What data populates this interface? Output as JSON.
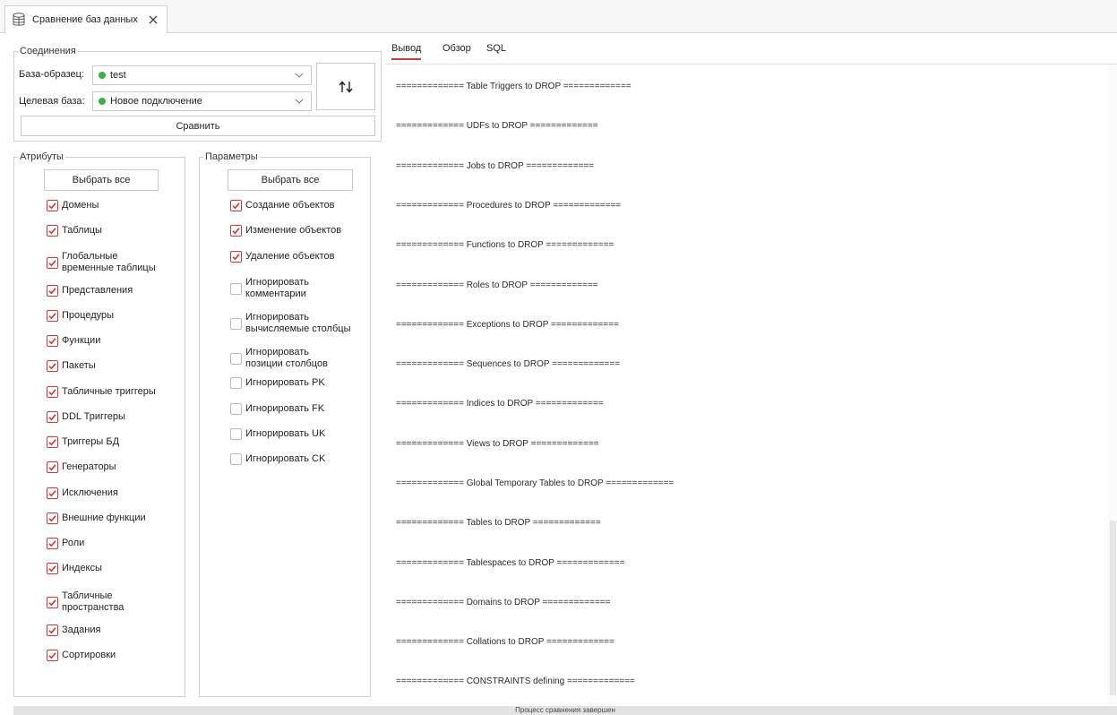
{
  "window": {
    "tab_title": "Сравнение баз данных",
    "tab_icon": "database-compare-icon",
    "close_icon": "close-icon"
  },
  "connections": {
    "title": "Соединения",
    "source_label": "База-образец:",
    "source_value": "test",
    "target_label": "Целевая база:",
    "target_value": "Новое подключение",
    "status_color": "#3cb043",
    "swap_icon": "swap-arrows-icon",
    "compare_button": "Сравнить"
  },
  "attributes": {
    "title": "Атрибуты",
    "select_all": "Выбрать все",
    "items": [
      {
        "label": "Домены",
        "checked": true
      },
      {
        "label": "Таблицы",
        "checked": true
      },
      {
        "label": "Глобальные\nвременные таблицы",
        "checked": true
      },
      {
        "label": "Представления",
        "checked": true
      },
      {
        "label": "Процедуры",
        "checked": true
      },
      {
        "label": "Функции",
        "checked": true
      },
      {
        "label": "Пакеты",
        "checked": true
      },
      {
        "label": "Табличные триггеры",
        "checked": true
      },
      {
        "label": "DDL Триггеры",
        "checked": true
      },
      {
        "label": "Триггеры БД",
        "checked": true
      },
      {
        "label": "Генераторы",
        "checked": true
      },
      {
        "label": "Исключения",
        "checked": true
      },
      {
        "label": "Внешние функции",
        "checked": true
      },
      {
        "label": "Роли",
        "checked": true
      },
      {
        "label": "Индексы",
        "checked": true
      },
      {
        "label": "Табличные\nпространства",
        "checked": true
      },
      {
        "label": "Задания",
        "checked": true
      },
      {
        "label": "Сортировки",
        "checked": true
      }
    ]
  },
  "parameters": {
    "title": "Параметры",
    "select_all": "Выбрать все",
    "items": [
      {
        "label": "Создание объектов",
        "checked": true
      },
      {
        "label": "Изменение объектов",
        "checked": true
      },
      {
        "label": "Удаление объектов",
        "checked": true
      },
      {
        "label": "Игнорировать\nкомментарии",
        "checked": false
      },
      {
        "label": "Игнорировать\nвычисляемые столбцы",
        "checked": false
      },
      {
        "label": "Игнорировать\nпозиции столбцов",
        "checked": false
      },
      {
        "label": "Игнорировать PK",
        "checked": false
      },
      {
        "label": "Игнорировать FK",
        "checked": false
      },
      {
        "label": "Игнорировать UK",
        "checked": false
      },
      {
        "label": "Игнорировать CK",
        "checked": false
      }
    ]
  },
  "output_tabs": [
    {
      "label": "Вывод",
      "active": true
    },
    {
      "label": "Обзор",
      "active": false
    },
    {
      "label": "SQL",
      "active": false
    }
  ],
  "output_lines": [
    "============= Table Triggers to DROP =============",
    "============= UDFs to DROP =============",
    "============= Jobs to DROP =============",
    "============= Procedures to DROP =============",
    "============= Functions to DROP =============",
    "============= Roles to DROP =============",
    "============= Exceptions to DROP =============",
    "============= Sequences to DROP =============",
    "============= Indices to DROP =============",
    "============= Views to DROP =============",
    "============= Global Temporary Tables to DROP =============",
    "============= Tables to DROP =============",
    "============= Tablespaces to DROP =============",
    "============= Domains to DROP =============",
    "============= Collations to DROP =============",
    "============= CONSTRAINTS defining ============="
  ],
  "status": "Процесс сравнения завершен",
  "colors": {
    "accent": "#d43535",
    "ok": "#3cb043"
  }
}
